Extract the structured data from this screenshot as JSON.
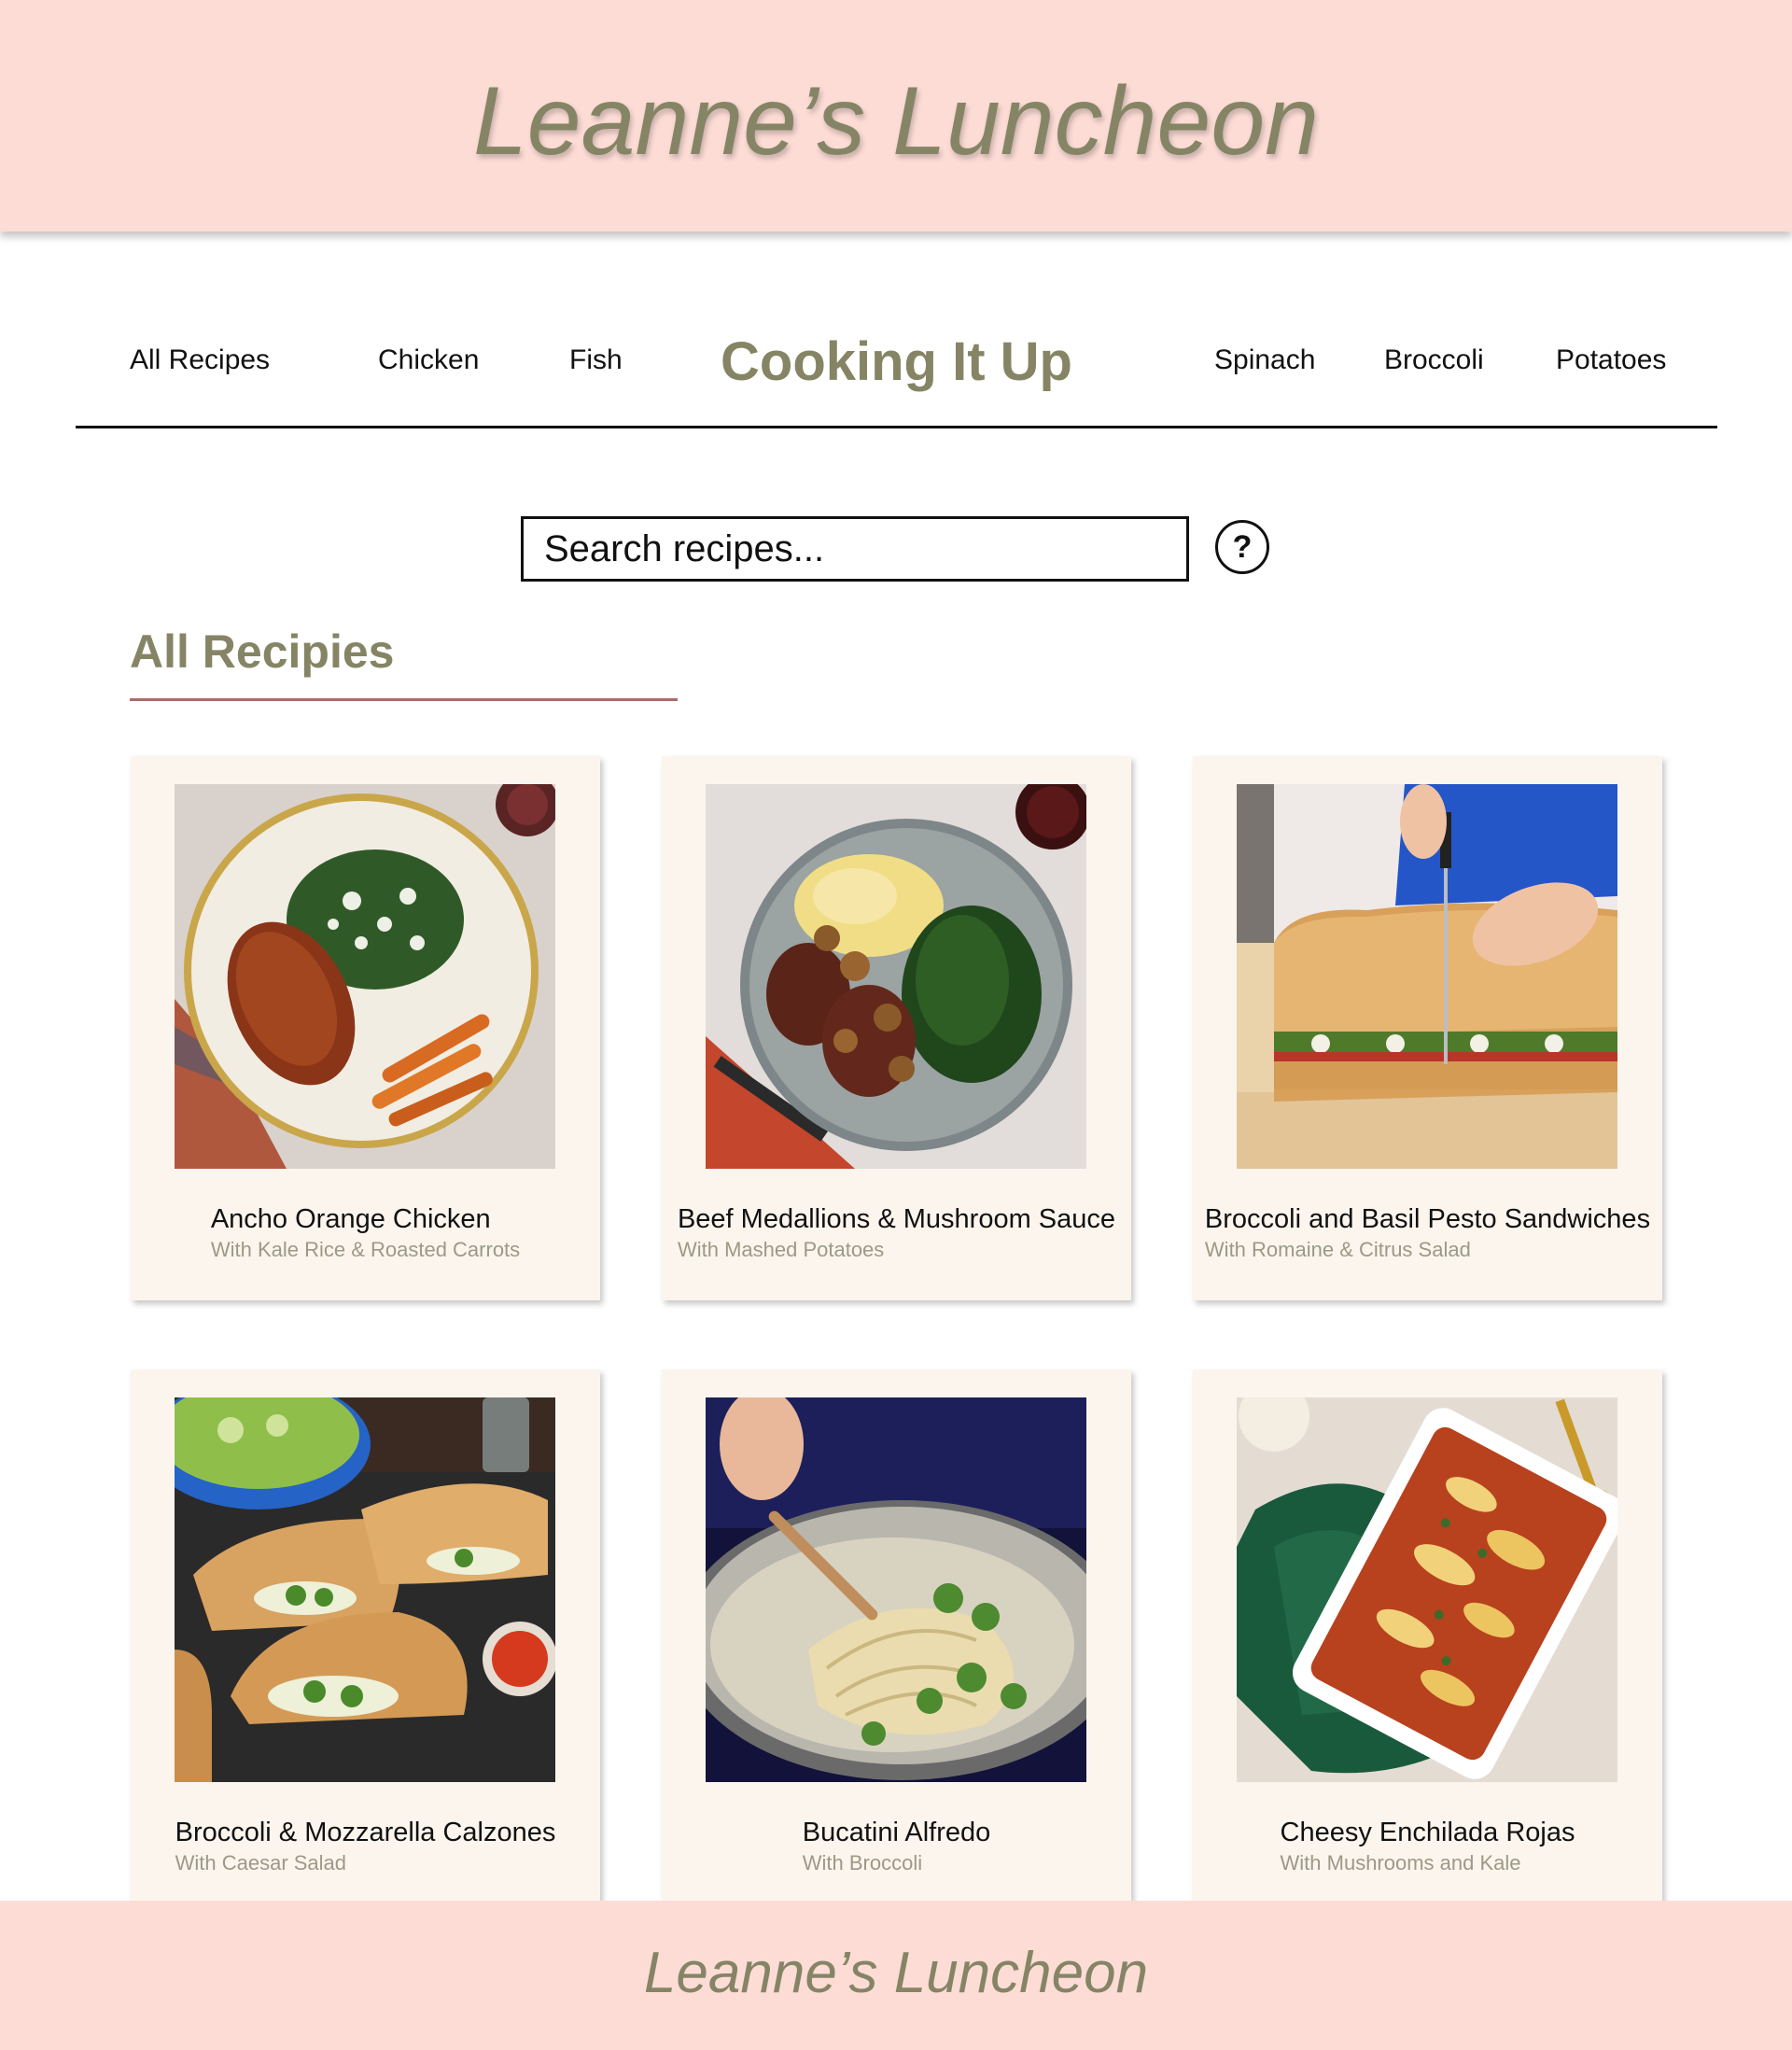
{
  "header": {
    "title": "Leanne’s Luncheon"
  },
  "nav": {
    "left_links": [
      "All Recipes",
      "Chicken",
      "Fish"
    ],
    "brand": "Cooking It Up",
    "right_links": [
      "Spinach",
      "Broccoli",
      "Potatoes"
    ]
  },
  "search": {
    "placeholder": "Search recipes...",
    "value": "",
    "help_label": "?"
  },
  "section": {
    "title": "All Recipies"
  },
  "recipes": [
    {
      "title": "Ancho Orange Chicken",
      "subtitle": "With Kale Rice & Roasted Carrots",
      "image_icon": "chicken-plate-photo"
    },
    {
      "title": "Beef Medallions & Mushroom Sauce",
      "subtitle": "With Mashed Potatoes",
      "image_icon": "beef-plate-photo"
    },
    {
      "title": "Broccoli and Basil Pesto Sandwiches",
      "subtitle": "With Romaine & Citrus Salad",
      "image_icon": "sandwich-photo"
    },
    {
      "title": "Broccoli & Mozzarella Calzones",
      "subtitle": "With Caesar Salad",
      "image_icon": "calzone-photo"
    },
    {
      "title": "Bucatini Alfredo",
      "subtitle": "With Broccoli",
      "image_icon": "pasta-pan-photo"
    },
    {
      "title": "Cheesy Enchilada Rojas",
      "subtitle": "With Mushrooms and Kale",
      "image_icon": "enchilada-dish-photo"
    }
  ],
  "footer": {
    "title": "Leanne’s Luncheon"
  },
  "colors": {
    "header_bg": "#fddcd6",
    "accent_olive": "#858566",
    "card_bg": "#fcf5ee",
    "underline": "#a07068",
    "subtitle_gray": "#9a9a86"
  }
}
